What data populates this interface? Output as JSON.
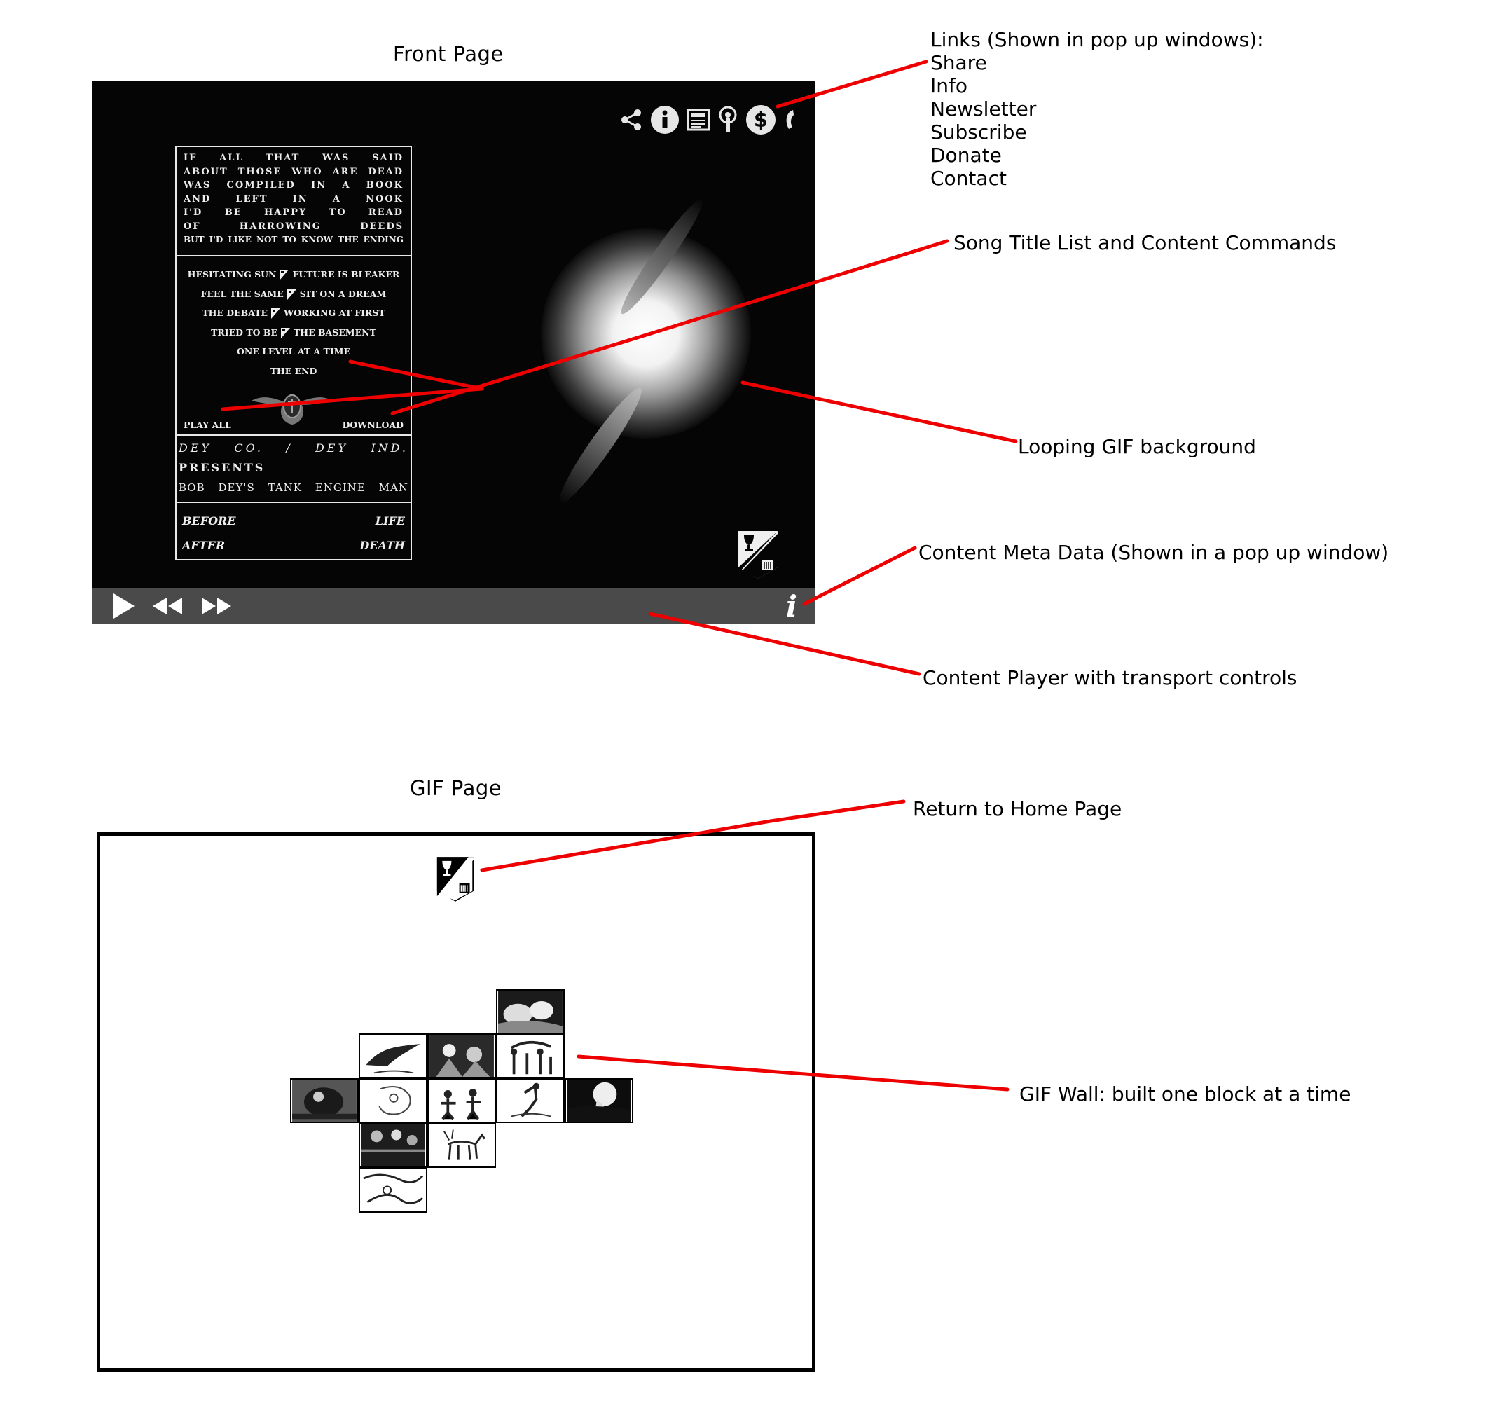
{
  "captions": {
    "front_page": "Front Page",
    "gif_page": "GIF Page"
  },
  "annotations": {
    "links_heading": "Links (Shown in pop up windows):",
    "links_items": [
      "Share",
      "Info",
      "Newsletter",
      "Subscribe",
      "Donate",
      "Contact"
    ],
    "song_list": "Song Title List and Content Commands",
    "looping_gif": "Looping GIF background",
    "meta_data": "Content Meta Data (Shown in a pop up window)",
    "player": "Content Player with transport controls",
    "return_home": "Return to Home Page",
    "gif_wall": "GIF Wall:  built one block at a time"
  },
  "front": {
    "poem_lines": [
      "IF ALL THAT WAS SAID",
      "ABOUT THOSE WHO ARE DEAD",
      "WAS COMPILED IN A BOOK",
      "AND LEFT IN A NOOK",
      "I'D BE HAPPY TO READ",
      "OF HARROWING DEEDS",
      "BUT I'D LIKE NOT TO KNOW THE ENDING"
    ],
    "songs": [
      [
        "HESITATING SUN",
        "FUTURE IS BLEAKER"
      ],
      [
        "FEEL THE SAME",
        "SIT ON A DREAM"
      ],
      [
        "THE DEBATE",
        "WORKING AT FIRST"
      ],
      [
        "TRIED TO BE",
        "THE BASEMENT"
      ],
      [
        "ONE LEVEL AT A TIME"
      ],
      [
        "THE END"
      ]
    ],
    "play_all": "PLAY ALL",
    "download": "DOWNLOAD",
    "credits": [
      "DEY CO. / DEY IND.",
      "PRESENTS",
      "BOB DEY'S TANK ENGINE MAN"
    ],
    "album_title": [
      "BEFORE LIFE",
      "AFTER DEATH"
    ],
    "link_icons": [
      "share-icon",
      "info-icon",
      "newsletter-icon",
      "subscribe-icon",
      "donate-icon",
      "contact-icon"
    ],
    "transport_icons": [
      "play-icon",
      "rewind-icon",
      "fast-forward-icon"
    ],
    "meta_icon_label": "i"
  },
  "colors": {
    "annotation_line": "#ee0000",
    "background": "#050505",
    "player_bar": "#4a4a4a"
  }
}
